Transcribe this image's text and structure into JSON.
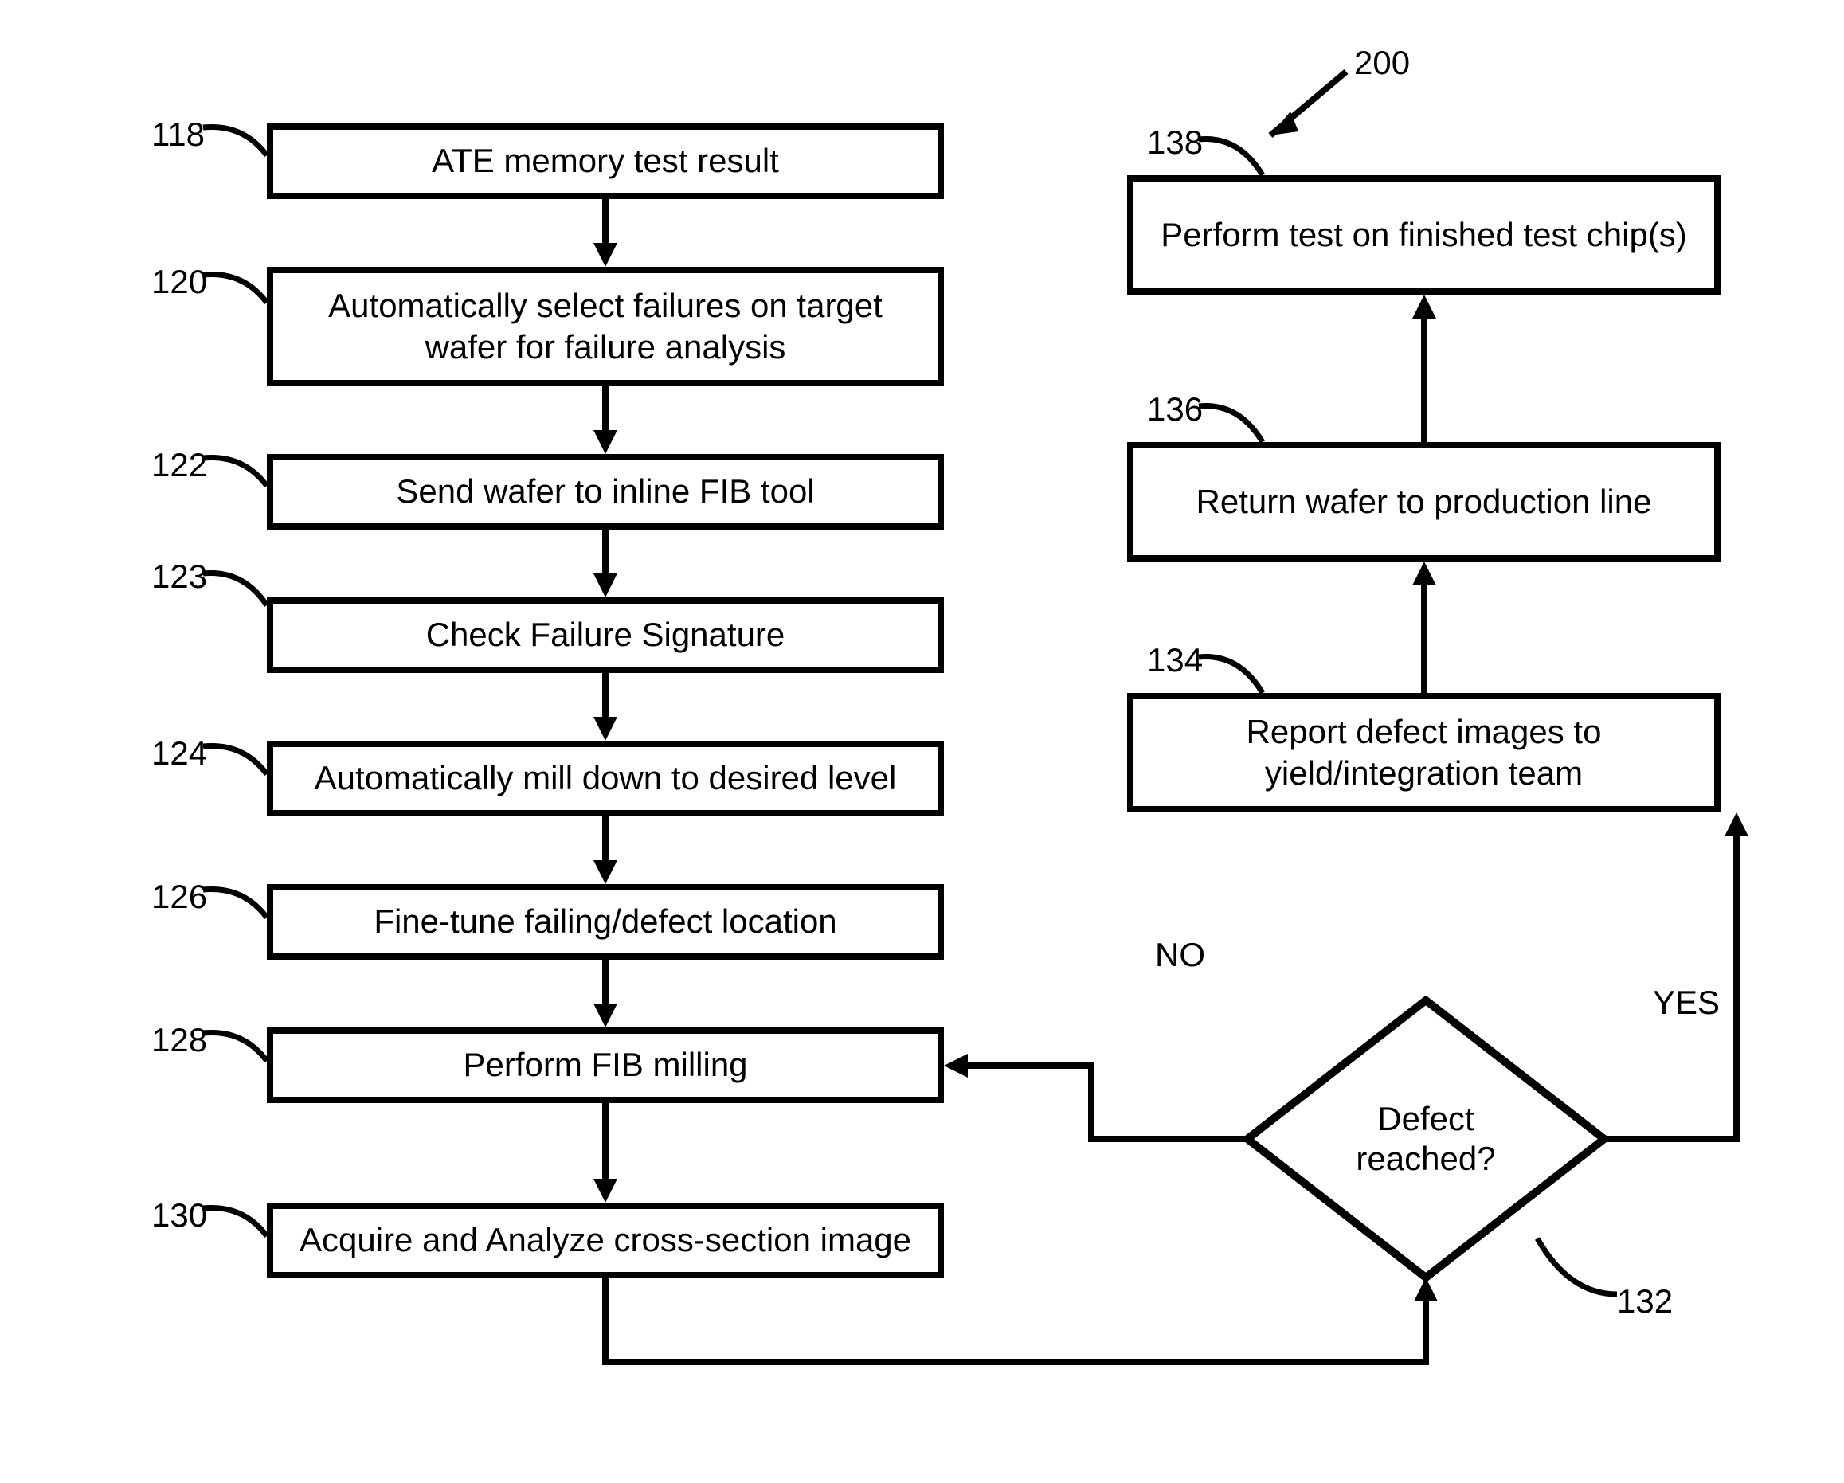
{
  "figure_ref": "200",
  "nodes": {
    "n118": {
      "ref": "118",
      "text": "ATE memory test result"
    },
    "n120": {
      "ref": "120",
      "text": "Automatically select failures on target wafer for failure analysis"
    },
    "n122": {
      "ref": "122",
      "text": "Send wafer to inline FIB tool"
    },
    "n123": {
      "ref": "123",
      "text": "Check Failure Signature"
    },
    "n124": {
      "ref": "124",
      "text": "Automatically mill down to desired level"
    },
    "n126": {
      "ref": "126",
      "text": "Fine-tune failing/defect location"
    },
    "n128": {
      "ref": "128",
      "text": "Perform FIB milling"
    },
    "n130": {
      "ref": "130",
      "text": "Acquire and Analyze cross-section image"
    },
    "n132": {
      "ref": "132",
      "text": "Defect reached?"
    },
    "n134": {
      "ref": "134",
      "text": "Report defect images to yield/integration team"
    },
    "n136": {
      "ref": "136",
      "text": "Return wafer to production line"
    },
    "n138": {
      "ref": "138",
      "text": "Perform test on finished test chip(s)"
    }
  },
  "edges": {
    "no_label": "NO",
    "yes_label": "YES"
  }
}
